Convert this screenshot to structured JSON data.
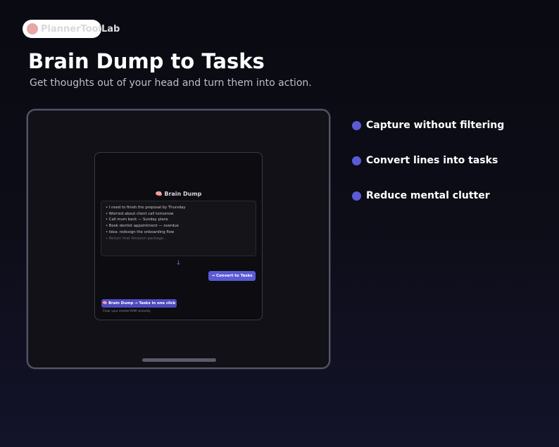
{
  "brand": {
    "name": "PlannerToolLab",
    "dot_color": "#e8a6a8"
  },
  "hero": {
    "title": "Brain Dump to Tasks",
    "subtitle": "Get thoughts out of your head and turn them into action."
  },
  "app": {
    "title_icon": "🧠",
    "title": "Brain Dump",
    "dump_lines": [
      "• I need to finish the proposal by Thursday",
      "• Worried about client call tomorrow",
      "• Call mum back — Sunday plans",
      "• Book dentist appointment — overdue",
      "• Idea: redesign the onboarding flow",
      "• Return that Amazon package..."
    ],
    "arrow": "↓",
    "convert_button": "→ Convert to Tasks",
    "badge": "🧠 Brain Dump → Tasks in one click",
    "badge_caption": "Clear your mental RAM instantly"
  },
  "features": [
    {
      "label": "Capture without filtering"
    },
    {
      "label": "Convert lines into tasks"
    },
    {
      "label": "Reduce mental clutter"
    }
  ],
  "colors": {
    "accent": "#5b5bd6",
    "background": "#0d0d18"
  }
}
